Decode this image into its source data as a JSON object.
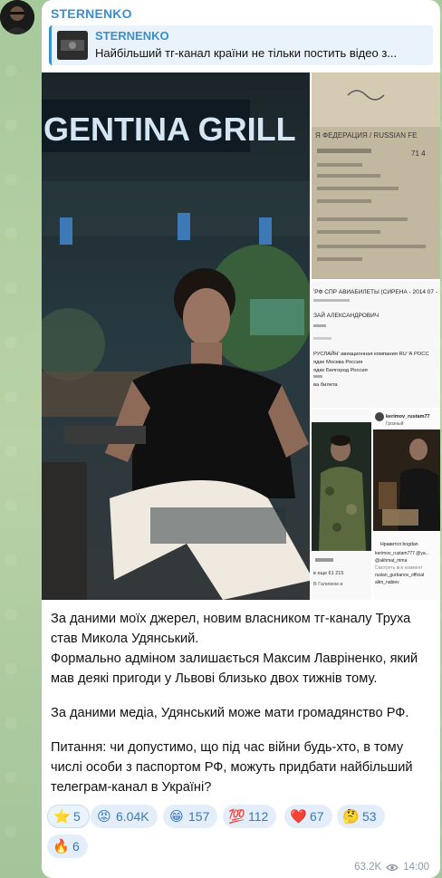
{
  "channel": {
    "name": "STERNENKO"
  },
  "forward": {
    "name": "STERNENKO",
    "text": "Найбільший тг-канал країни не тільки постить відео з..."
  },
  "media": {
    "main_sign": "GENTINA GRILL",
    "ticket_header": "'РФ СПР АВИАБИЛЕТЫ (СИРЕНА - 2014 07 -",
    "ticket_name": "ЗАЙ АЛЕКСАНДРОВИЧ",
    "ticket_line3": "РУСЛАЙН' авиационная компания RU 'А РОСС",
    "ticket_line4": "ядке Москва Россия",
    "ticket_line5": "ядке Белгород Россия",
    "ticket_line6": "ва билета",
    "insta_user": "kerimov_rustam77",
    "insta_location": "Грозный",
    "insta_likes": "Нравится bogdan",
    "insta_c1": "kerimov_rustam777 @ya...",
    "insta_c2": "@akhmat_mma",
    "insta_c3": "Смотреть все коммент",
    "insta_c4": "ruslan_gurbanov_official",
    "insta_c5": "alim_nabiev",
    "insta_left1": "в еще 61 215",
    "insta_left2": "В Галимом и",
    "doc_header": "Я ФЕДЕРАЦИЯ / RUSSIAN FE",
    "doc_line": "71 4"
  },
  "post": {
    "p1": "За даними моїх джерел, новим власником тг-каналу Труха став Микола Удянський.",
    "p2": "Формально адміном залишається Максим Лавріненко, який мав деякі пригоди у Львові близько двох тижнів тому.",
    "p3": "За даними медіа, Удянський може мати громадянство РФ.",
    "p4": "Питання: чи допустимо, що під час війни будь-хто, в тому числі особи з паспортом РФ, можуть придбати найбільший телеграм-канал в Україні?"
  },
  "reactions": [
    {
      "emoji": "⭐",
      "count": "5",
      "icon": "star-icon"
    },
    {
      "emoji": "😡",
      "count": "6.04K",
      "icon": "angry-face-icon"
    },
    {
      "emoji": "😁",
      "count": "157",
      "icon": "grin-face-icon"
    },
    {
      "emoji": "💯",
      "count": "112",
      "icon": "hundred-icon"
    },
    {
      "emoji": "❤️",
      "count": "67",
      "icon": "heart-icon"
    },
    {
      "emoji": "🤔",
      "count": "53",
      "icon": "thinking-face-icon"
    },
    {
      "emoji": "🔥",
      "count": "6",
      "icon": "fire-icon"
    }
  ],
  "meta": {
    "views": "63.2K",
    "time": "14:00"
  },
  "colors": {
    "accent": "#3a8fce",
    "reaction_bg": "#e4eefa",
    "chat_bg": "#a9c9a0"
  }
}
